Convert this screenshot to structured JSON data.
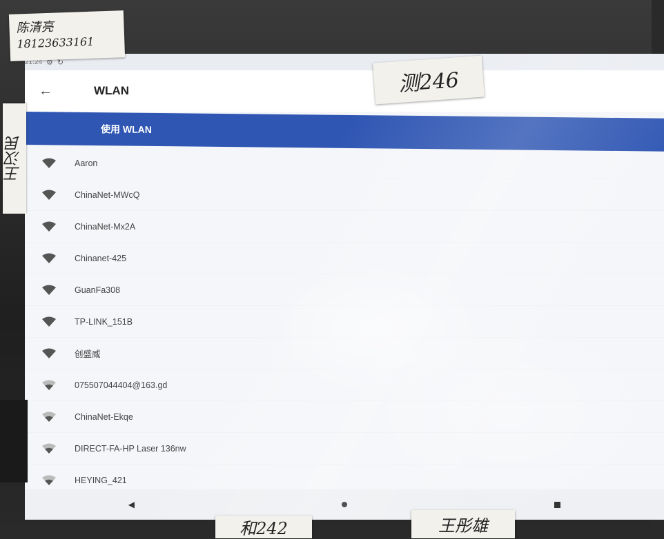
{
  "statusbar": {
    "time": "21:24",
    "icons": [
      "gear-icon",
      "sync-icon"
    ]
  },
  "appbar": {
    "back_icon": "arrow-left-icon",
    "title": "WLAN"
  },
  "master_toggle": {
    "label": "使用 WLAN"
  },
  "networks": [
    {
      "name": "Aaron",
      "icon": "wifi-filled-icon"
    },
    {
      "name": "ChinaNet-MWcQ",
      "icon": "wifi-filled-icon"
    },
    {
      "name": "ChinaNet-Mx2A",
      "icon": "wifi-filled-icon"
    },
    {
      "name": "Chinanet-425",
      "icon": "wifi-filled-icon"
    },
    {
      "name": "GuanFa308",
      "icon": "wifi-filled-icon"
    },
    {
      "name": "TP-LINK_151B",
      "icon": "wifi-filled-icon"
    },
    {
      "name": "创盛威",
      "icon": "wifi-filled-icon"
    },
    {
      "name": "075507044404@163.gd",
      "icon": "wifi-weak-icon"
    },
    {
      "name": "ChinaNet-Ekqe",
      "icon": "wifi-weak-icon"
    },
    {
      "name": "DIRECT-FA-HP Laser 136nw",
      "icon": "wifi-weak-icon"
    },
    {
      "name": "HEYING_421",
      "icon": "wifi-weak-icon"
    }
  ],
  "navbar": {
    "back_icon": "nav-back-icon",
    "back_glyph": "◀",
    "home_icon": "nav-home-icon",
    "recent_icon": "nav-recent-icon"
  },
  "notes": {
    "top_left_line1": "陈清亮",
    "top_left_line2": "18123633161",
    "top_center": "测246",
    "left_side": "王汉民",
    "bottom_1": "和242",
    "bottom_2": "王彤雄"
  },
  "colors": {
    "accent": "#2f56b3",
    "screen_bg": "#f4f6f9",
    "icon": "#555555"
  }
}
